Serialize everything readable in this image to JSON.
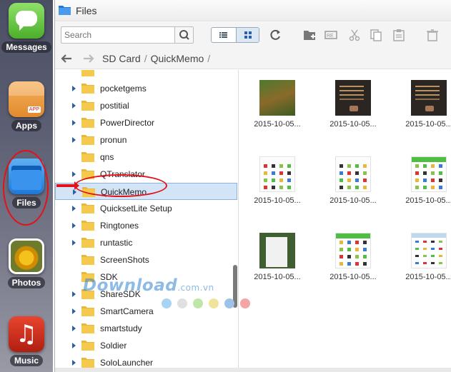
{
  "dock": {
    "messages_label": "Messages",
    "apps_label": "Apps",
    "apps_badge": "APP",
    "files_label": "Files",
    "photos_label": "Photos",
    "music_label": "Music",
    "music_glyph": "♫"
  },
  "window": {
    "title": "Files"
  },
  "toolbar": {
    "search_placeholder": "Search",
    "icons": [
      "list-view-icon",
      "grid-view-icon",
      "refresh-icon",
      "new-folder-icon",
      "rename-icon",
      "cut-icon",
      "copy-icon",
      "paste-icon",
      "delete-icon"
    ]
  },
  "path": {
    "crumbs": [
      "SD Card",
      "QuickMemo"
    ],
    "separator": "/"
  },
  "tree": {
    "items": [
      {
        "label": "",
        "has_children": false
      },
      {
        "label": "pocketgems",
        "has_children": true
      },
      {
        "label": "postitial",
        "has_children": true
      },
      {
        "label": "PowerDirector",
        "has_children": true
      },
      {
        "label": "pronun",
        "has_children": true
      },
      {
        "label": "qns",
        "has_children": false
      },
      {
        "label": "QTranslator",
        "has_children": true
      },
      {
        "label": "QuickMemo",
        "has_children": true,
        "selected": true
      },
      {
        "label": "QuicksetLite Setup",
        "has_children": true
      },
      {
        "label": "Ringtones",
        "has_children": true
      },
      {
        "label": "runtastic",
        "has_children": true
      },
      {
        "label": "ScreenShots",
        "has_children": false
      },
      {
        "label": "SDK",
        "has_children": false
      },
      {
        "label": "ShareSDK",
        "has_children": true
      },
      {
        "label": "SmartCamera",
        "has_children": true
      },
      {
        "label": "smartstudy",
        "has_children": true
      },
      {
        "label": "Soldier",
        "has_children": true
      },
      {
        "label": "SoloLauncher",
        "has_children": true
      }
    ]
  },
  "files": [
    {
      "caption": "2015-10-05...",
      "thumb": "game"
    },
    {
      "caption": "2015-10-05...",
      "thumb": "dark"
    },
    {
      "caption": "2015-10-05...",
      "thumb": "dark"
    },
    {
      "caption": "2015-10-05...",
      "thumb": "white"
    },
    {
      "caption": "2015-10-05...",
      "thumb": "white"
    },
    {
      "caption": "2015-10-05...",
      "thumb": "greenhdr"
    },
    {
      "caption": "2015-10-05...",
      "thumb": "darkgreen"
    },
    {
      "caption": "2015-10-05...",
      "thumb": "greenhdr"
    },
    {
      "caption": "2015-10-05...",
      "thumb": "bluehdr"
    }
  ],
  "watermark": {
    "text": "Download",
    "suffix": ".com.vn",
    "dot_colors": [
      "#a9d3f2",
      "#e0e0e0",
      "#bfe6a8",
      "#f2e39a",
      "#9cc2ea",
      "#f4a5a5"
    ]
  },
  "colors": {
    "accent_red": "#e3121a",
    "selection_bg": "#d4e4f7",
    "folder_yellow": "#f5c94c"
  }
}
